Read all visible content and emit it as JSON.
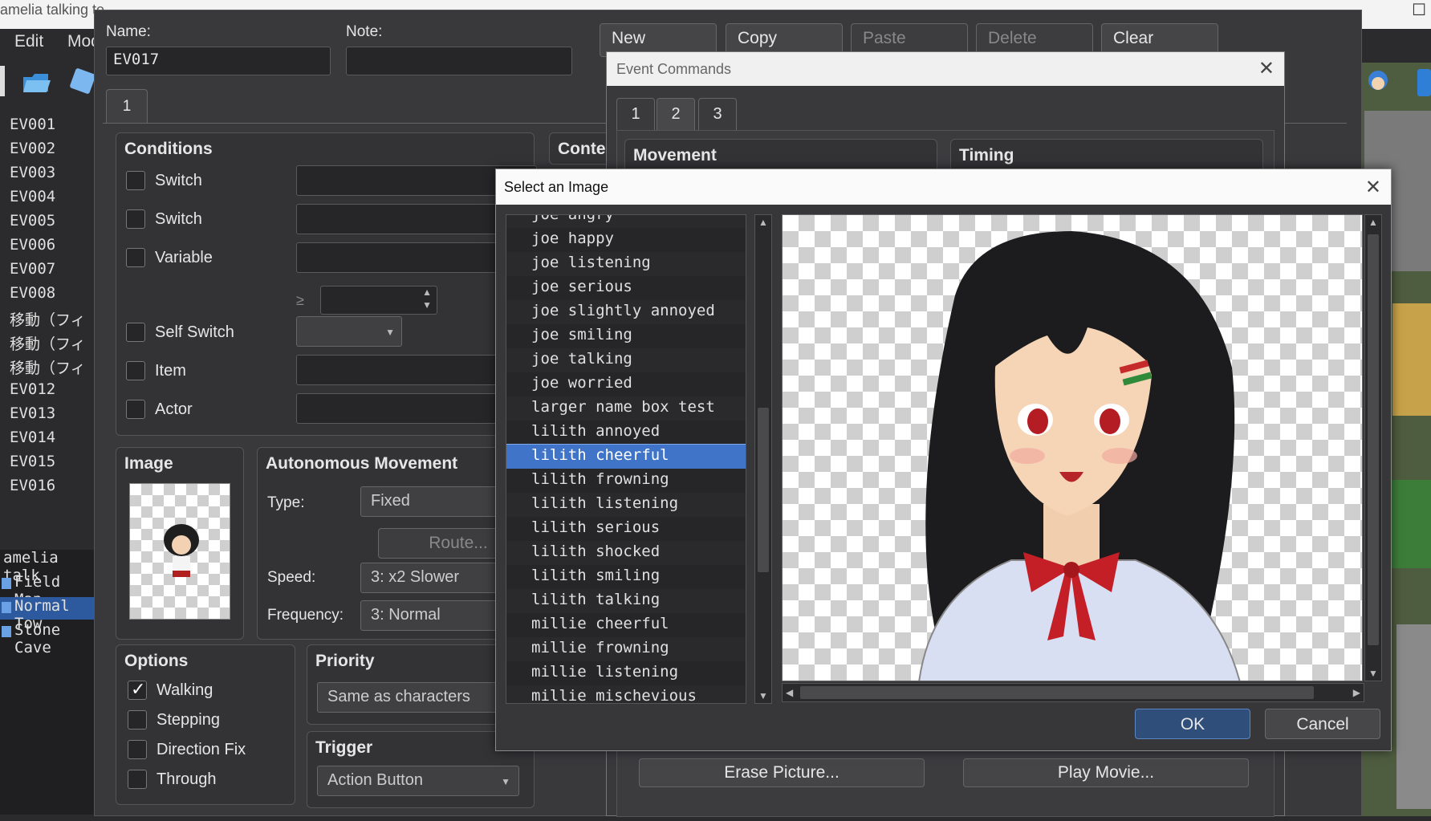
{
  "bg_window": {
    "title": "amelia talking te",
    "menu": [
      "Edit",
      "Mod"
    ]
  },
  "event_list": [
    "EV001",
    "EV002",
    "EV003",
    "EV004",
    "EV005",
    "EV006",
    "EV007",
    "EV008",
    "移動（フィ",
    "移動（フィ",
    "移動（フィ",
    "EV012",
    "EV013",
    "EV014",
    "EV015",
    "EV016"
  ],
  "map_tree": [
    {
      "label": "amelia talk",
      "selected": false
    },
    {
      "label": "Field Map",
      "selected": false
    },
    {
      "label": "Normal Tow",
      "selected": true
    },
    {
      "label": "Stone Cave",
      "selected": false
    }
  ],
  "editor": {
    "name_label": "Name:",
    "name_value": "EV017",
    "note_label": "Note:",
    "note_value": "",
    "buttons": {
      "new": "New",
      "copy": "Copy",
      "paste": "Paste",
      "delete": "Delete",
      "clear": "Clear"
    },
    "page_tab": "1",
    "conditions": {
      "title": "Conditions",
      "items": [
        {
          "label": "Switch"
        },
        {
          "label": "Switch"
        },
        {
          "label": "Variable"
        },
        {
          "label": "Self Switch"
        },
        {
          "label": "Item"
        },
        {
          "label": "Actor"
        }
      ],
      "ge_symbol": "≥"
    },
    "contents_title": "Conte",
    "image": {
      "title": "Image"
    },
    "autonomous": {
      "title": "Autonomous Movement",
      "type_label": "Type:",
      "type_value": "Fixed",
      "route_button": "Route...",
      "speed_label": "Speed:",
      "speed_value": "3: x2 Slower",
      "freq_label": "Frequency:",
      "freq_value": "3: Normal"
    },
    "options": {
      "title": "Options",
      "items": [
        {
          "label": "Walking",
          "checked": true
        },
        {
          "label": "Stepping",
          "checked": false
        },
        {
          "label": "Direction Fix",
          "checked": false
        },
        {
          "label": "Through",
          "checked": false
        }
      ]
    },
    "priority": {
      "title": "Priority",
      "value": "Same as characters"
    },
    "trigger": {
      "title": "Trigger",
      "value": "Action Button"
    }
  },
  "event_commands": {
    "title": "Event Commands",
    "tabs": [
      "1",
      "2",
      "3"
    ],
    "active_tab": "2",
    "groups": [
      "Movement",
      "Timing"
    ],
    "buttons": [
      "Erase Picture...",
      "Play Movie..."
    ]
  },
  "image_dialog": {
    "title": "Select an Image",
    "files": [
      "joe angry",
      "joe happy",
      "joe listening",
      "joe serious",
      "joe slightly annoyed",
      "joe smiling",
      "joe talking",
      "joe worried",
      "larger name box test",
      "lilith annoyed",
      "lilith cheerful",
      "lilith frowning",
      "lilith listening",
      "lilith serious",
      "lilith shocked",
      "lilith smiling",
      "lilith talking",
      "millie cheerful",
      "millie frowning",
      "millie listening",
      "millie mischevious"
    ],
    "selected": "lilith cheerful",
    "ok": "OK",
    "cancel": "Cancel"
  },
  "colors": {
    "selection": "#3f74c9",
    "dialog_bg": "#37373a",
    "ok_button": "#2f4f7a"
  }
}
